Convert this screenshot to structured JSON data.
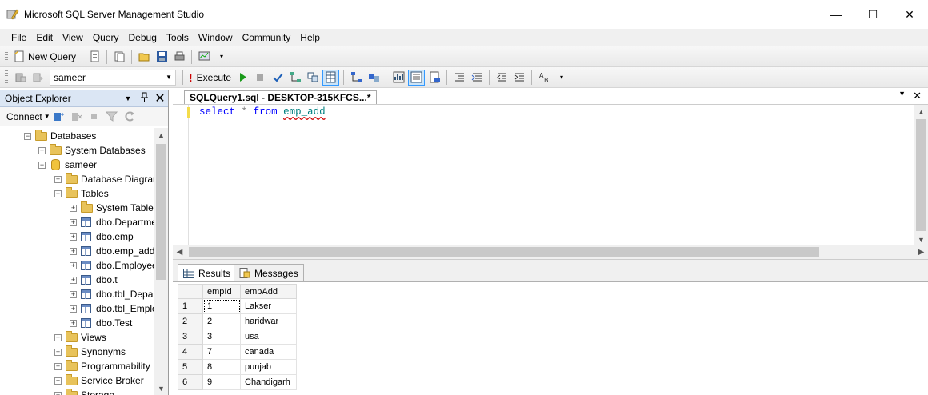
{
  "window": {
    "title": "Microsoft SQL Server Management Studio",
    "minimize": "—",
    "maximize": "☐",
    "close": "✕"
  },
  "menu": [
    "File",
    "Edit",
    "View",
    "Query",
    "Debug",
    "Tools",
    "Window",
    "Community",
    "Help"
  ],
  "toolbar1": {
    "new_query": "New Query"
  },
  "toolbar2": {
    "database": "sameer",
    "execute": "Execute"
  },
  "object_explorer": {
    "title": "Object Explorer",
    "connect": "Connect",
    "tree": [
      {
        "label": "Databases",
        "level": 0,
        "toggle": "−",
        "icon": "folder"
      },
      {
        "label": "System Databases",
        "level": 1,
        "toggle": "+",
        "icon": "folder"
      },
      {
        "label": "sameer",
        "level": 1,
        "toggle": "−",
        "icon": "database"
      },
      {
        "label": "Database Diagrams",
        "level": 2,
        "toggle": "+",
        "icon": "folder"
      },
      {
        "label": "Tables",
        "level": 2,
        "toggle": "−",
        "icon": "folder"
      },
      {
        "label": "System Tables",
        "level": 3,
        "toggle": "+",
        "icon": "folder"
      },
      {
        "label": "dbo.Department",
        "level": 3,
        "toggle": "+",
        "icon": "table"
      },
      {
        "label": "dbo.emp",
        "level": 3,
        "toggle": "+",
        "icon": "table"
      },
      {
        "label": "dbo.emp_add",
        "level": 3,
        "toggle": "+",
        "icon": "table"
      },
      {
        "label": "dbo.Employee",
        "level": 3,
        "toggle": "+",
        "icon": "table"
      },
      {
        "label": "dbo.t",
        "level": 3,
        "toggle": "+",
        "icon": "table"
      },
      {
        "label": "dbo.tbl_Department",
        "level": 3,
        "toggle": "+",
        "icon": "table"
      },
      {
        "label": "dbo.tbl_Employee",
        "level": 3,
        "toggle": "+",
        "icon": "table"
      },
      {
        "label": "dbo.Test",
        "level": 3,
        "toggle": "+",
        "icon": "table"
      },
      {
        "label": "Views",
        "level": 2,
        "toggle": "+",
        "icon": "folder"
      },
      {
        "label": "Synonyms",
        "level": 2,
        "toggle": "+",
        "icon": "folder"
      },
      {
        "label": "Programmability",
        "level": 2,
        "toggle": "+",
        "icon": "folder"
      },
      {
        "label": "Service Broker",
        "level": 2,
        "toggle": "+",
        "icon": "folder"
      },
      {
        "label": "Storage",
        "level": 2,
        "toggle": "+",
        "icon": "folder"
      }
    ]
  },
  "editor": {
    "tab_title": "SQLQuery1.sql - DESKTOP-315KFCS...*",
    "close": "✕",
    "code": {
      "kw1": "select",
      "op": "*",
      "kw2": "from",
      "table": "emp_add"
    }
  },
  "results": {
    "tabs": [
      "Results",
      "Messages"
    ],
    "columns": [
      "empId",
      "empAdd"
    ],
    "rows": [
      [
        "1",
        "1",
        "Lakser"
      ],
      [
        "2",
        "2",
        "haridwar"
      ],
      [
        "3",
        "3",
        "usa"
      ],
      [
        "4",
        "7",
        "canada"
      ],
      [
        "5",
        "8",
        "punjab"
      ],
      [
        "6",
        "9",
        "Chandigarh"
      ]
    ]
  },
  "colors": {
    "title_bg": "#ffffff",
    "menu_bg": "#f0f0f0",
    "pane_header": "#dbe6f4",
    "keyword": "#0000ff",
    "identifier": "#008080"
  }
}
